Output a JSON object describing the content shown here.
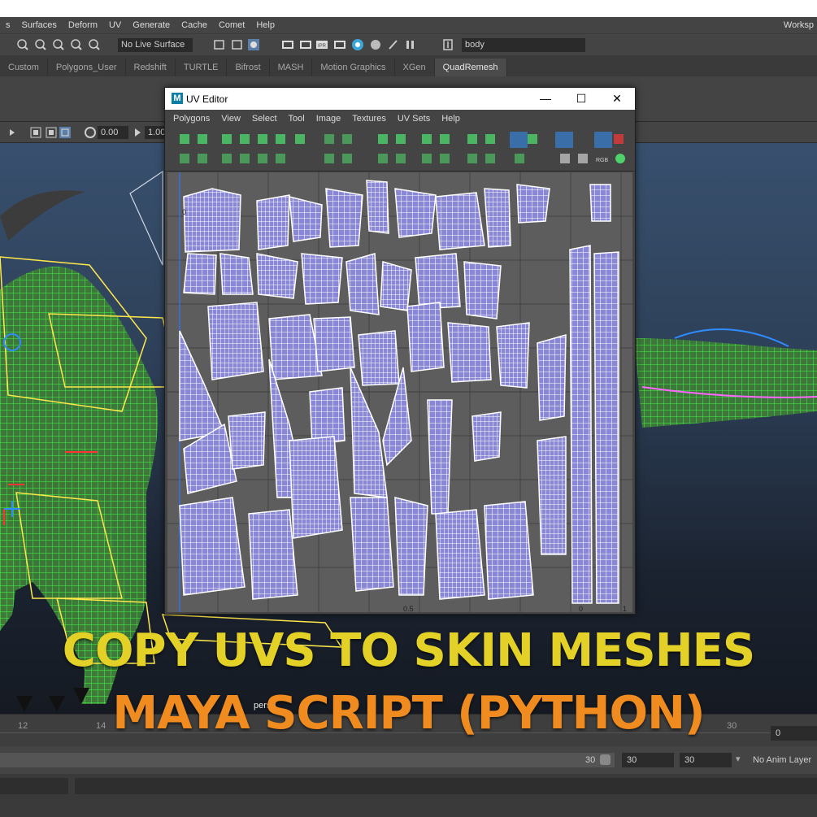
{
  "menubar": {
    "items": [
      "s",
      "Surfaces",
      "Deform",
      "UV",
      "Generate",
      "Cache",
      "Comet",
      "Help"
    ],
    "workspace": "Worksp"
  },
  "statusline": {
    "live_surface": "No Live Surface",
    "object_field": "body"
  },
  "shelf_tabs": [
    "Custom",
    "Polygons_User",
    "Redshift",
    "TURTLE",
    "Bifrost",
    "MASH",
    "Motion Graphics",
    "XGen",
    "QuadRemesh"
  ],
  "shelf_active_tab": "QuadRemesh",
  "viewport_toolbar": {
    "value_a": "0.00",
    "value_b": "1.00"
  },
  "viewport": {
    "camera_label": "persp"
  },
  "uv_editor": {
    "title": "UV Editor",
    "menu": [
      "Polygons",
      "View",
      "Select",
      "Tool",
      "Image",
      "Textures",
      "UV Sets",
      "Help"
    ],
    "axis_labels": [
      "0",
      "0.5",
      "0",
      "1"
    ],
    "colors": {
      "canvas": "#5d5d5d",
      "shell_fill": "#8a88d6",
      "shell_line": "#ffffff"
    }
  },
  "time_slider": {
    "ticks": [
      "12",
      "14",
      "30"
    ],
    "current_frame": "0"
  },
  "range_bar": {
    "end_a": "30",
    "end_b": "30",
    "end_c": "30",
    "anim_layer": "No Anim Layer"
  },
  "caption": {
    "line1": "COPY UVS TO SKIN MESHES",
    "line2": "MAYA SCRIPT (PYTHON)",
    "line1_color": "#e3d127",
    "line2_color": "#ef8b1f"
  }
}
